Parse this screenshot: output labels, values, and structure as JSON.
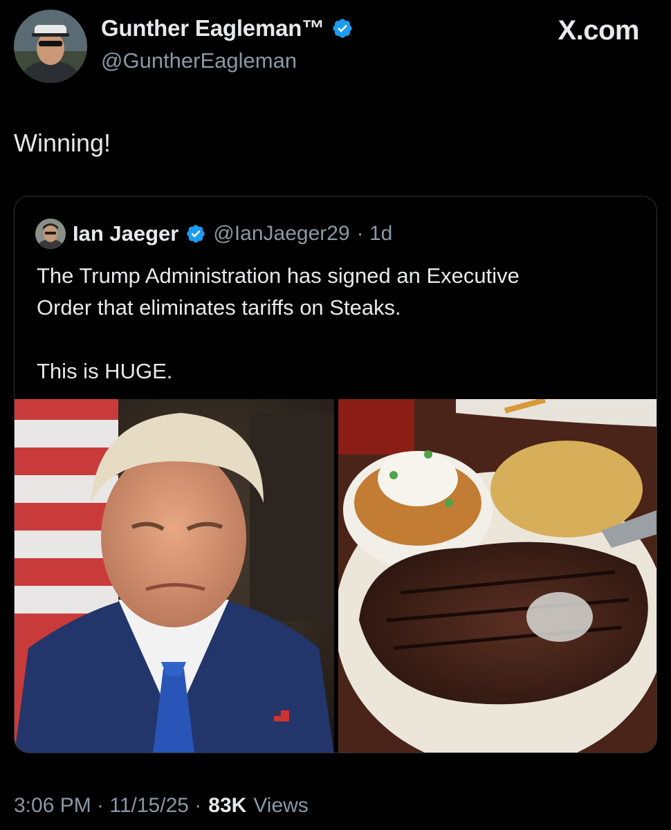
{
  "post": {
    "author": {
      "display_name": "Gunther Eagleman™",
      "handle": "@GuntherEagleman",
      "verified_color": "#1d9bf0"
    },
    "brand": "X.com",
    "text": "Winning!",
    "timestamp": "3:06 PM · 11/15/25 ·",
    "views_count": "83K",
    "views_label": "Views"
  },
  "quoted_post": {
    "author": {
      "display_name": "Ian Jaeger",
      "handle": "@IanJaeger29",
      "age": "· 1d"
    },
    "text": "The Trump Administration has signed an Executive\nOrder that eliminates tariffs on Steaks.\n\nThis is HUGE.",
    "media": [
      {
        "icon": "portrait-photo"
      },
      {
        "icon": "steak-dinner-photo"
      }
    ]
  },
  "colors": {
    "background": "#000000",
    "primary_text": "#e7e9ea",
    "secondary_text": "#8b98a5",
    "border": "#2f3336",
    "verified": "#1d9bf0"
  }
}
